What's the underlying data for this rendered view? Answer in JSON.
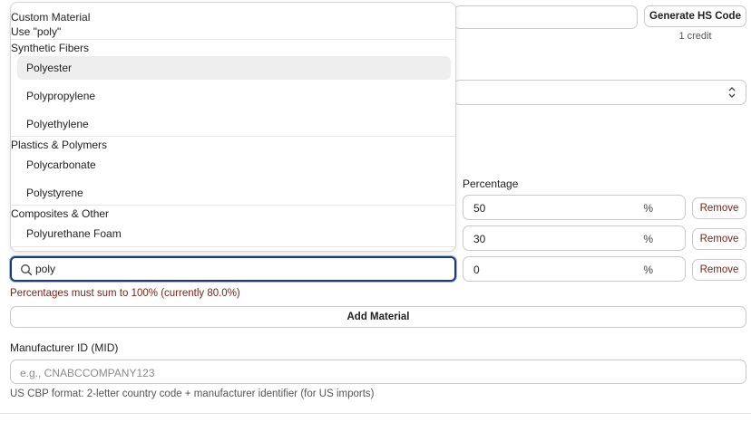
{
  "hs": {
    "input_value": "",
    "generate_label": "Generate HS Code",
    "credit_text": "1 credit"
  },
  "select": {
    "value": ""
  },
  "materials": {
    "percentage_label": "Percentage",
    "rows": [
      {
        "percent": "50",
        "unit": "%",
        "remove_label": "Remove"
      },
      {
        "percent": "30",
        "unit": "%",
        "remove_label": "Remove"
      },
      {
        "percent": "0",
        "unit": "%",
        "remove_label": "Remove"
      }
    ],
    "search_value": "poly",
    "error_text": "Percentages must sum to 100% (currently 80.0%)",
    "add_label": "Add Material"
  },
  "dropdown": {
    "custom_heading": "Custom Material",
    "custom_use": "Use \"poly\"",
    "groups": [
      {
        "label": "Synthetic Fibers",
        "items": [
          "Polyester",
          "Polypropylene",
          "Polyethylene"
        ]
      },
      {
        "label": "Plastics & Polymers",
        "items": [
          "Polycarbonate",
          "Polystyrene"
        ]
      },
      {
        "label": "Composites & Other",
        "items": [
          "Polyurethane Foam"
        ]
      }
    ],
    "highlighted_item": "Polyester"
  },
  "mid": {
    "label": "Manufacturer ID (MID)",
    "placeholder": "e.g., CNABCCOMPANY123",
    "help": "US CBP format: 2-letter country code + manufacturer identifier (for US imports)"
  },
  "colors": {
    "error": "#7a1f14",
    "focus_border": "#1f3a7a",
    "highlight": "#eeeeee"
  }
}
